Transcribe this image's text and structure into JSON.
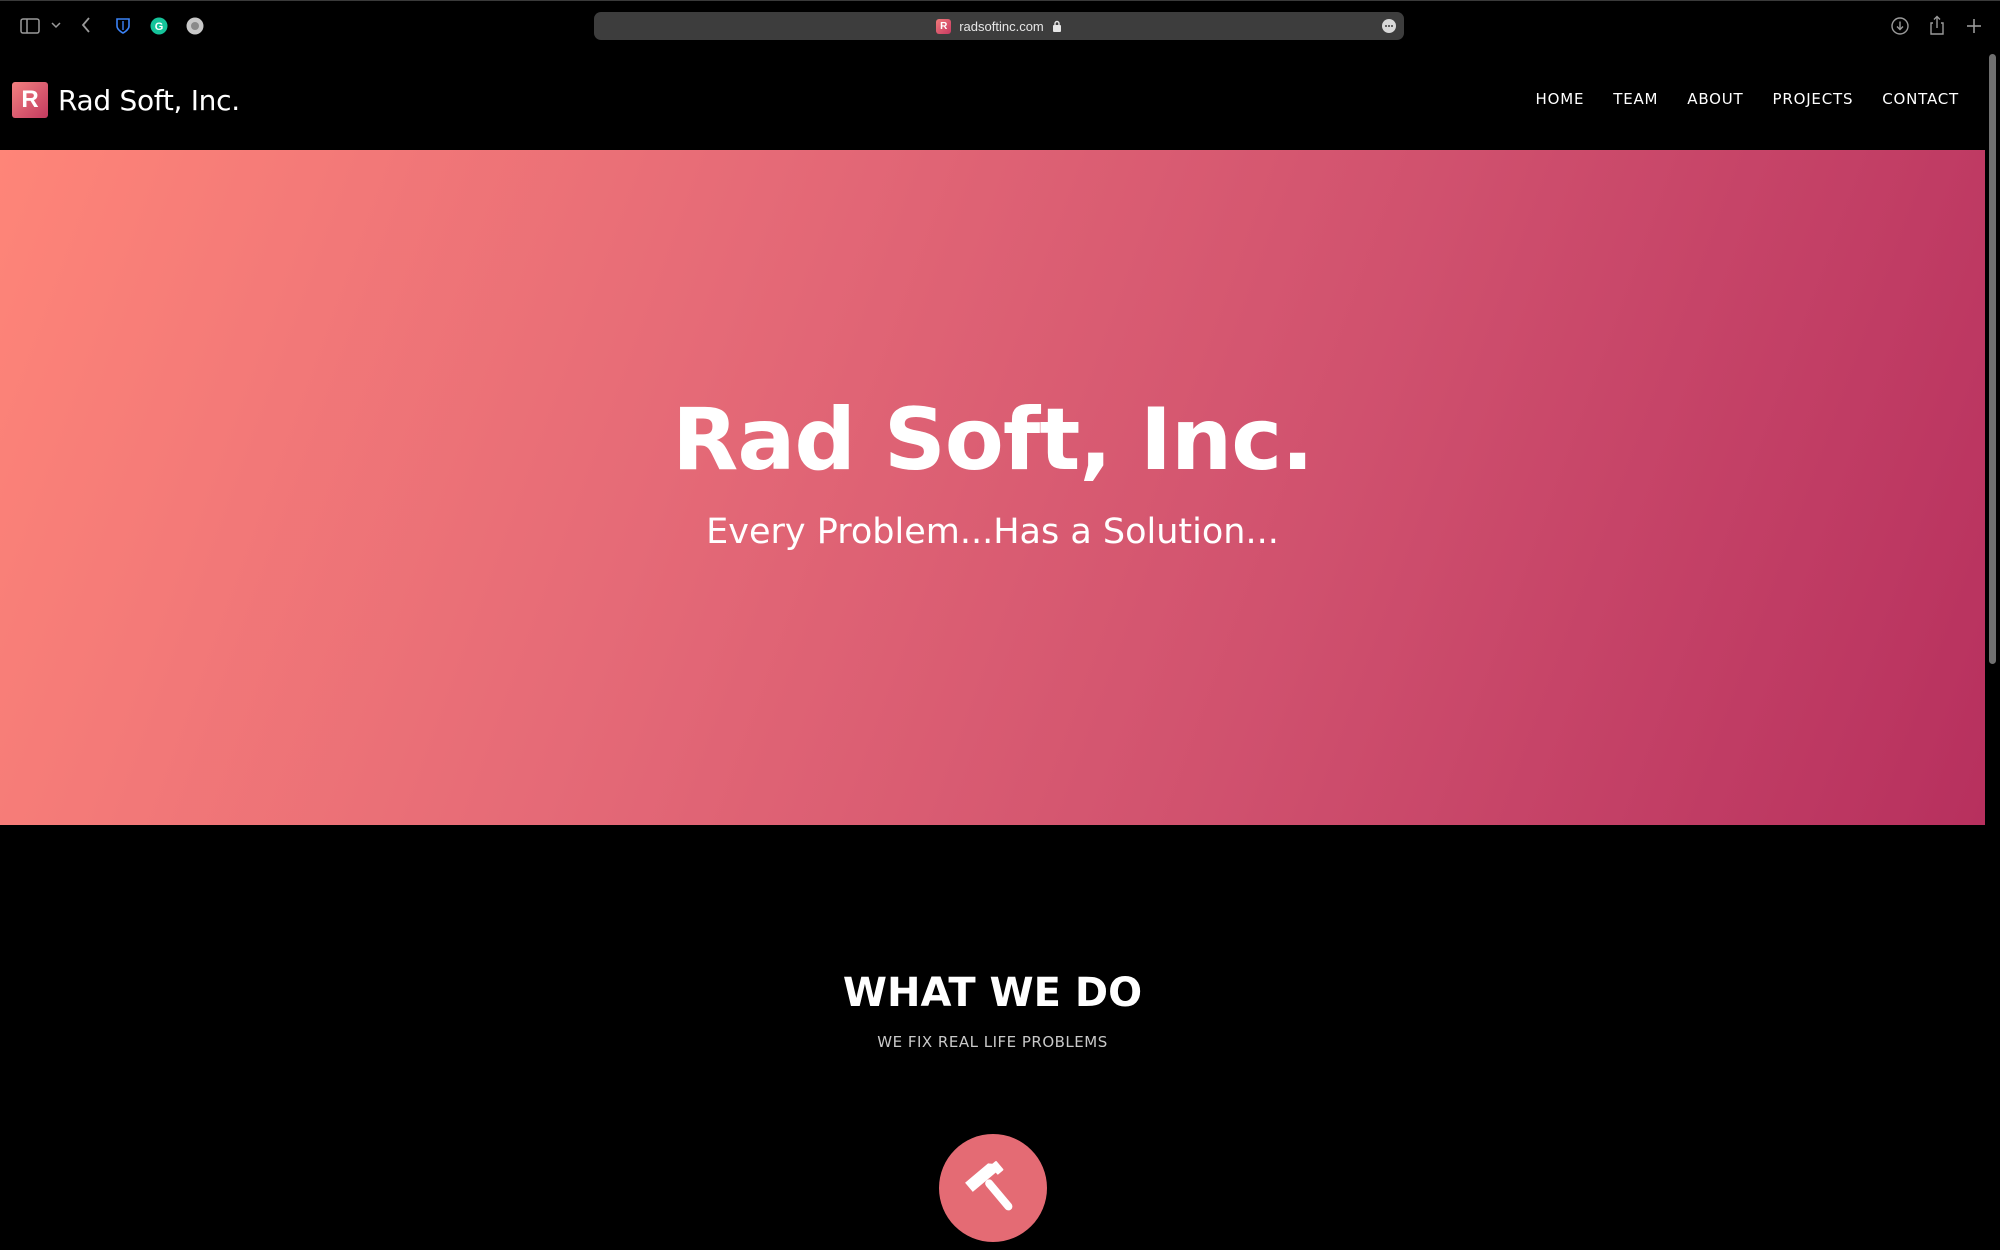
{
  "browser": {
    "url": "radsoftinc.com",
    "favicon_letter": "R",
    "toolbar_icons": [
      "sidebar-icon",
      "chevron-down-icon",
      "back-icon",
      "bitwarden-icon",
      "grammarly-icon",
      "extension-icon",
      "download-icon",
      "share-icon",
      "new-tab-icon"
    ]
  },
  "site": {
    "logo_letter": "R",
    "brand_name": "Rad Soft, Inc.",
    "nav": [
      "HOME",
      "TEAM",
      "ABOUT",
      "PROJECTS",
      "CONTACT"
    ]
  },
  "hero": {
    "title": "Rad Soft, Inc.",
    "subtitle": "Every Problem...Has a Solution..."
  },
  "services": {
    "title": "WHAT WE DO",
    "subtitle": "WE FIX REAL LIFE PROBLEMS",
    "icon": "hammer-icon"
  },
  "colors": {
    "hero_gradient_start": "#fe8578",
    "hero_gradient_end": "#b7305e",
    "accent": "#e46b74"
  }
}
